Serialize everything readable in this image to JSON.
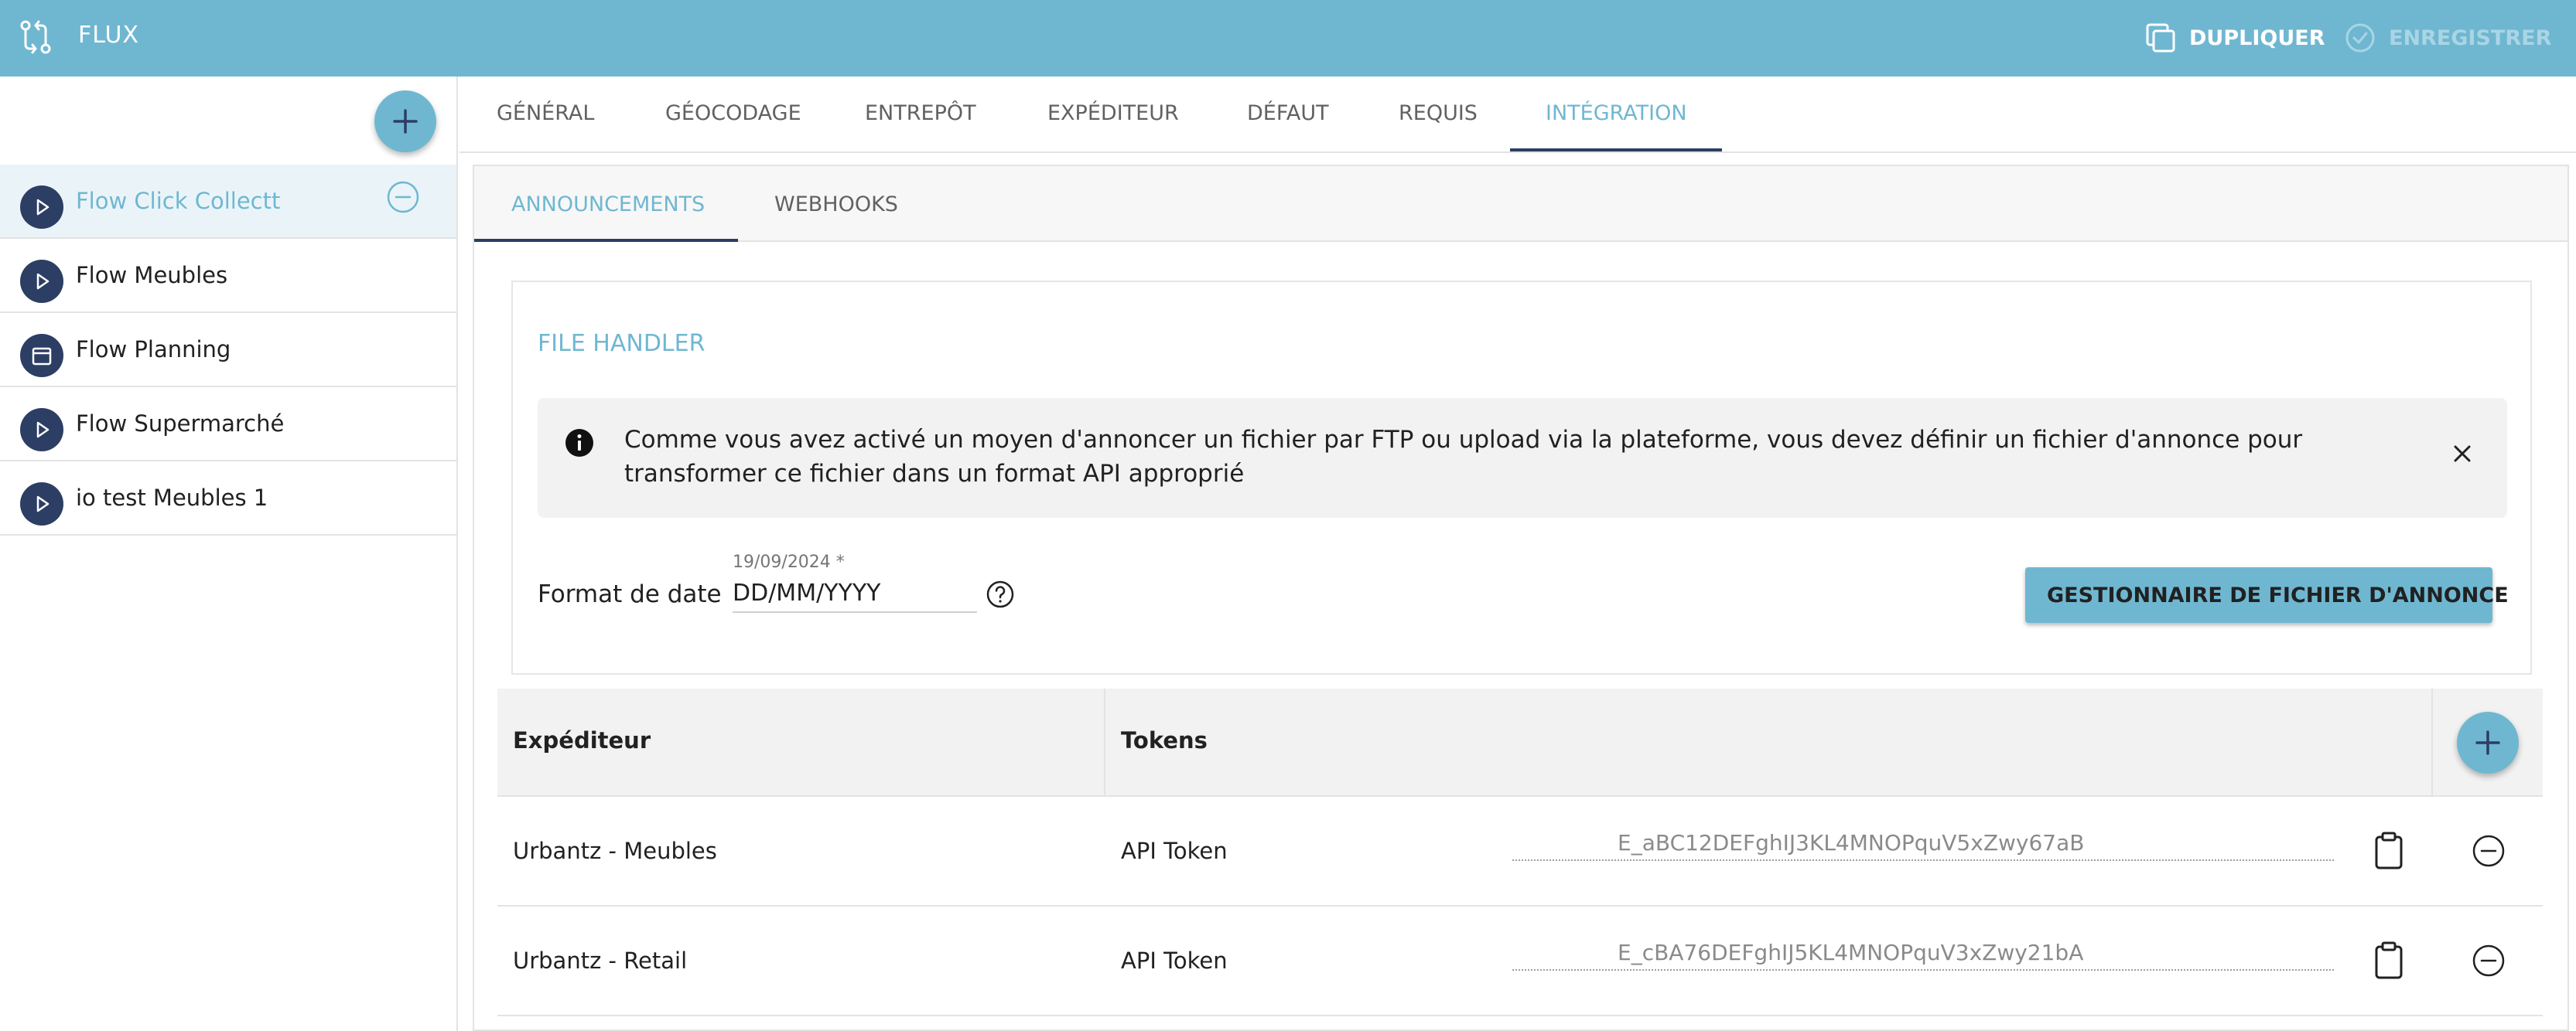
{
  "app": {
    "title": "FLUX",
    "icon": "branch-merge-icon"
  },
  "top_actions": {
    "duplicate_label": "DUPLIQUER",
    "save_label": "ENREGISTRER"
  },
  "flows": [
    {
      "label": "Flow Click Collectt",
      "icon": "play-icon",
      "active": true
    },
    {
      "label": "Flow Meubles",
      "icon": "play-icon"
    },
    {
      "label": "Flow Planning",
      "icon": "calendar-icon"
    },
    {
      "label": "Flow Supermarché",
      "icon": "play-icon"
    },
    {
      "label": "io test Meubles 1",
      "icon": "play-icon"
    }
  ],
  "tabs": [
    "GÉNÉRAL",
    "GÉOCODAGE",
    "ENTREPÔT",
    "EXPÉDITEUR",
    "DÉFAUT",
    "REQUIS",
    "INTÉGRATION"
  ],
  "active_tab": "INTÉGRATION",
  "sub_tabs": [
    "ANNOUNCEMENTS",
    "WEBHOOKS"
  ],
  "active_sub_tab": "ANNOUNCEMENTS",
  "file_handler": {
    "title": "FILE HANDLER",
    "info_text": "Comme vous avez activé un moyen d'annoncer un fichier par FTP ou upload via la plateforme, vous devez définir un fichier d'annonce pour transformer ce fichier dans un format API approprié",
    "date_format_label": "Format de date",
    "date_hint": "19/09/2024 *",
    "date_format_value": "DD/MM/YYYY",
    "manager_button": "GESTIONNAIRE DE FICHIER D'ANNONCE"
  },
  "table": {
    "headers": {
      "shipper": "Expéditeur",
      "tokens": "Tokens"
    },
    "rows": [
      {
        "shipper": "Urbantz - Meubles",
        "token_type": "API Token",
        "token": "E_aBC12DEFghIJ3KL4MNOPquV5xZwy67aB"
      },
      {
        "shipper": "Urbantz - Retail",
        "token_type": "API Token",
        "token": "E_cBA76DEFghIJ5KL4MNOPquV3xZwy21bA"
      }
    ]
  },
  "colors": {
    "accent": "#6fb7d1",
    "navy": "#2c3e63",
    "header_bg": "#f2f2f2"
  }
}
